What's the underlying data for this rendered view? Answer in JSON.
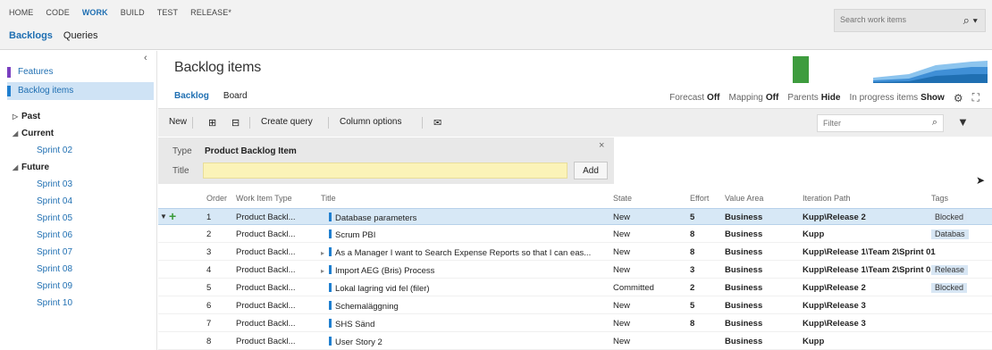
{
  "hubs": [
    "HOME",
    "CODE",
    "WORK",
    "BUILD",
    "TEST",
    "RELEASE*"
  ],
  "hubs_active_index": 2,
  "subnav": {
    "backlogs": "Backlogs",
    "queries": "Queries"
  },
  "search": {
    "placeholder": "Search work items",
    "icon": "search-icon"
  },
  "left": {
    "features": "Features",
    "backlog_items": "Backlog items",
    "past": "Past",
    "current": "Current",
    "future": "Future",
    "current_sprints": [
      "Sprint 02"
    ],
    "future_sprints": [
      "Sprint 03",
      "Sprint 04",
      "Sprint 05",
      "Sprint 06",
      "Sprint 07",
      "Sprint 08",
      "Sprint 09",
      "Sprint 10"
    ]
  },
  "main": {
    "title": "Backlog items",
    "tabs": {
      "backlog": "Backlog",
      "board": "Board"
    },
    "options": {
      "forecast_label": "Forecast",
      "forecast_value": "Off",
      "mapping_label": "Mapping",
      "mapping_value": "Off",
      "parents_label": "Parents",
      "parents_value": "Hide",
      "inprogress_label": "In progress items",
      "inprogress_value": "Show"
    }
  },
  "toolbar": {
    "new": "New",
    "create_query": "Create query",
    "column_options": "Column options",
    "filter_placeholder": "Filter"
  },
  "add_panel": {
    "type_label": "Type",
    "type_value": "Product Backlog Item",
    "title_label": "Title",
    "add_button": "Add"
  },
  "grid": {
    "headers": {
      "order": "Order",
      "type": "Work Item Type",
      "title": "Title",
      "state": "State",
      "effort": "Effort",
      "value": "Value Area",
      "iteration": "Iteration Path",
      "tags": "Tags"
    },
    "rows": [
      {
        "order": "1",
        "type": "Product Backl...",
        "title": "Database parameters",
        "state": "New",
        "effort": "5",
        "value": "Business",
        "iteration": "Kupp\\Release 2",
        "tags": "Blocked"
      },
      {
        "order": "2",
        "type": "Product Backl...",
        "title": "Scrum PBI",
        "state": "New",
        "effort": "8",
        "value": "Business",
        "iteration": "Kupp",
        "tags": "Databas"
      },
      {
        "order": "3",
        "type": "Product Backl...",
        "title": "As a Manager I want to Search Expense Reports so that I can eas...",
        "state": "New",
        "effort": "8",
        "value": "Business",
        "iteration": "Kupp\\Release 1\\Team 2\\Sprint 01",
        "tags": ""
      },
      {
        "order": "4",
        "type": "Product Backl...",
        "title": "Import AEG (Bris) Process",
        "state": "New",
        "effort": "3",
        "value": "Business",
        "iteration": "Kupp\\Release 1\\Team 2\\Sprint 01",
        "tags": "Release"
      },
      {
        "order": "5",
        "type": "Product Backl...",
        "title": "Lokal lagring vid fel (filer)",
        "state": "Committed",
        "effort": "2",
        "value": "Business",
        "iteration": "Kupp\\Release 2",
        "tags": "Blocked"
      },
      {
        "order": "6",
        "type": "Product Backl...",
        "title": "Schemaläggning",
        "state": "New",
        "effort": "5",
        "value": "Business",
        "iteration": "Kupp\\Release 3",
        "tags": ""
      },
      {
        "order": "7",
        "type": "Product Backl...",
        "title": "SHS Sänd",
        "state": "New",
        "effort": "8",
        "value": "Business",
        "iteration": "Kupp\\Release 3",
        "tags": ""
      },
      {
        "order": "8",
        "type": "Product Backl...",
        "title": "User Story 2",
        "state": "New",
        "effort": "",
        "value": "Business",
        "iteration": "Kupp",
        "tags": ""
      }
    ]
  },
  "colors": {
    "accent": "#1f6fb2",
    "feature": "#7a3fc0",
    "pbi": "#1f7fcf",
    "selected_row": "#d7e8f6",
    "title_input": "#fbf3b8"
  }
}
